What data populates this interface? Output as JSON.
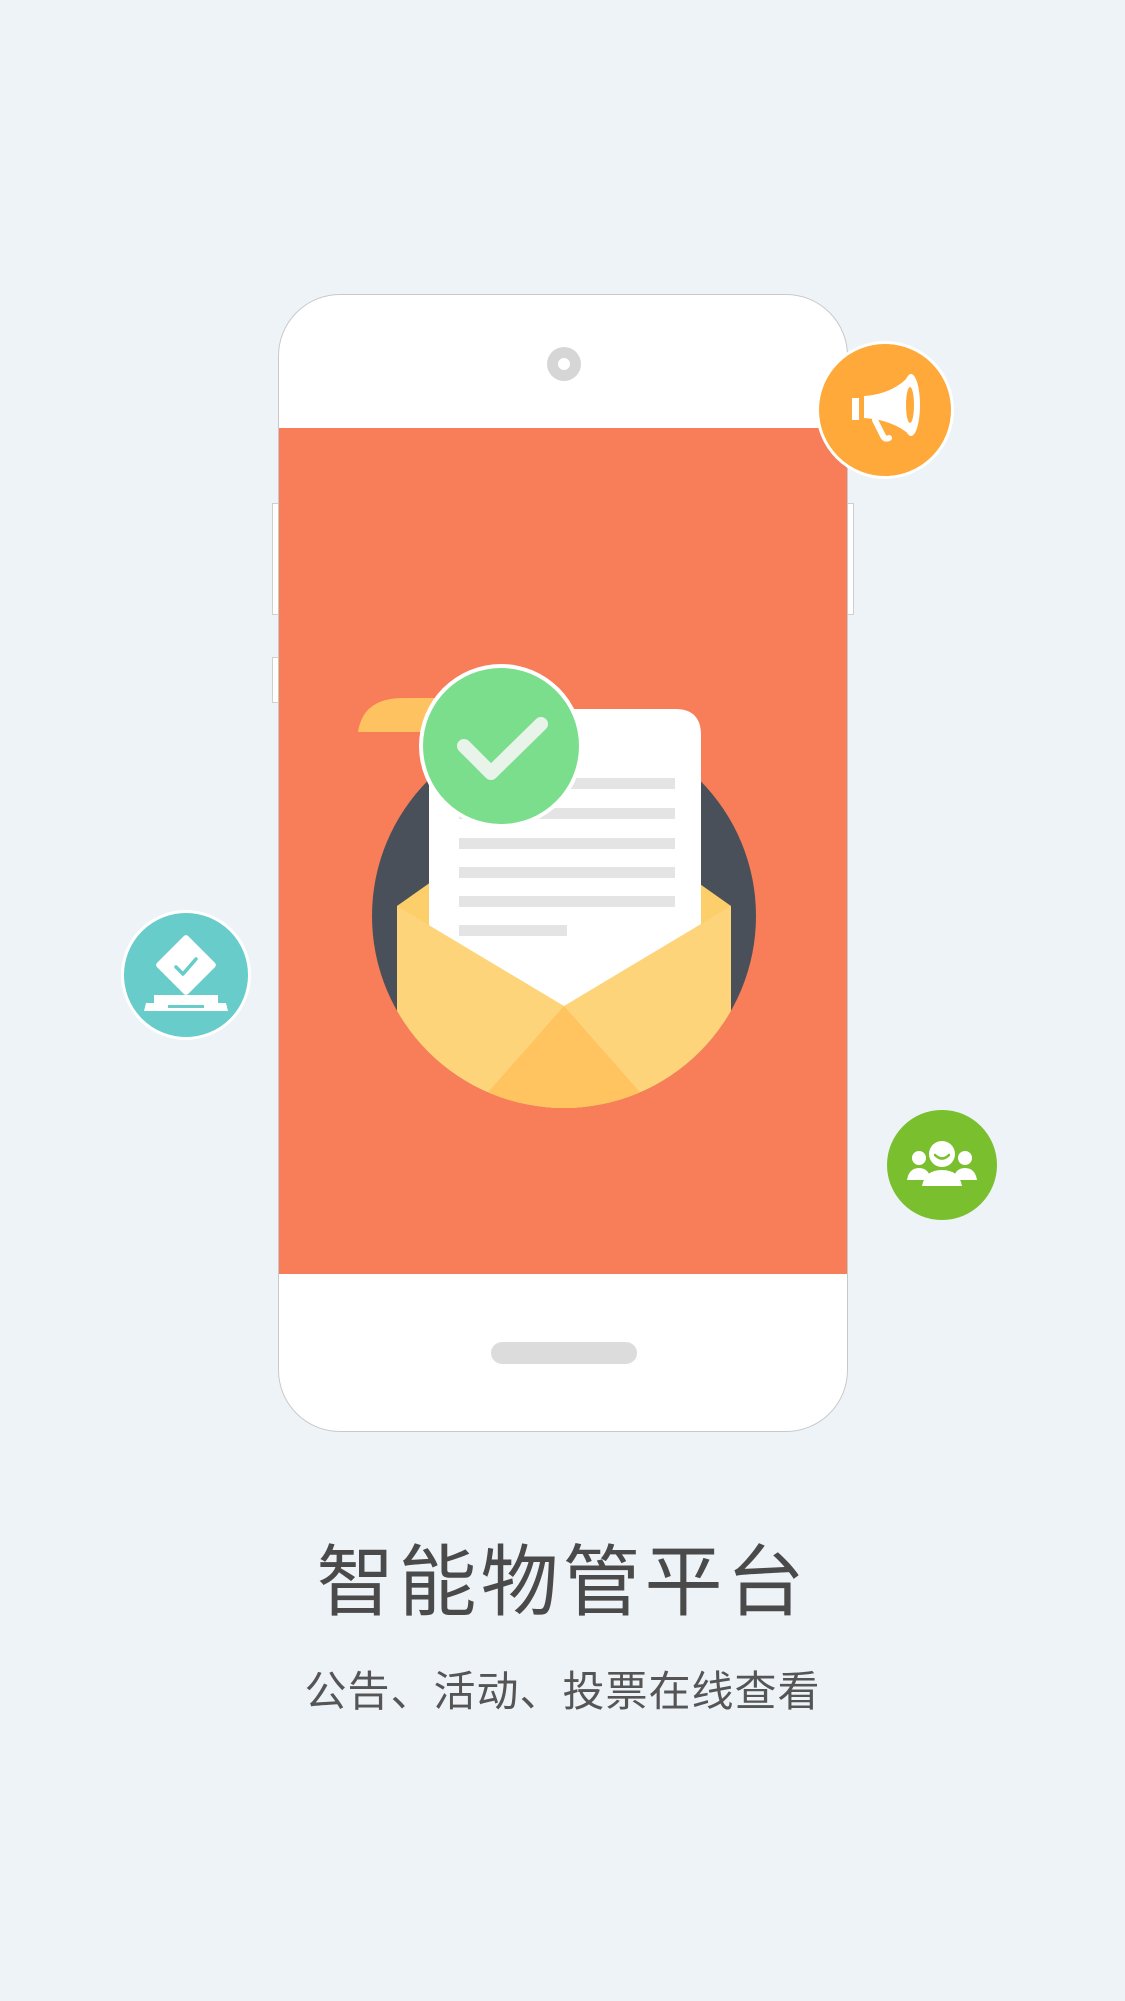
{
  "title": "智能物管平台",
  "subtitle": "公告、活动、投票在线查看",
  "icons": {
    "megaphone": "megaphone-icon",
    "vote": "ballot-box-icon",
    "group": "user-group-icon",
    "mail": "open-envelope-icon",
    "check": "checkmark-icon"
  },
  "colors": {
    "background": "#eef3f8",
    "screen": "#f77e59",
    "megaphone_bubble": "#ffa93a",
    "vote_bubble": "#67ccca",
    "group_bubble": "#7abf2e",
    "check_badge": "#7ade8c",
    "envelope": "#fdd47a",
    "envelope_dark_circle": "#4a505a"
  }
}
